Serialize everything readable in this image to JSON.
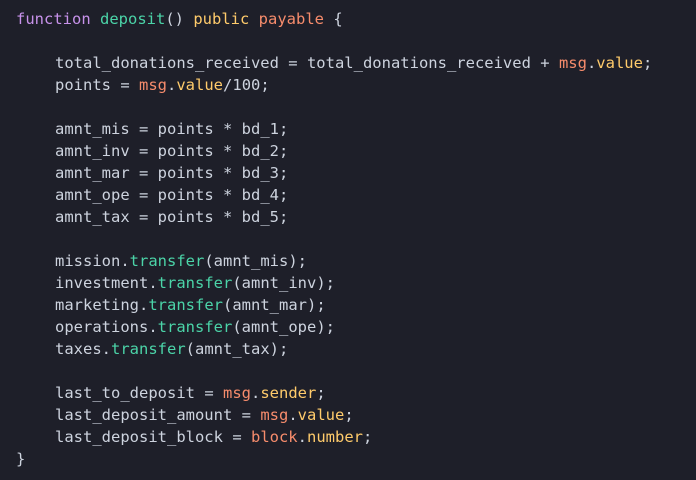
{
  "editor": {
    "background": "#1e1f29",
    "token_colors": {
      "keyword": "#c792ea",
      "function": "#82aaff",
      "member": "#f78c6c",
      "property": "#ffcb6b",
      "method": "#4bd4a8",
      "number": "#f78c6c",
      "text": "#cdd3de",
      "operator": "#89ddff",
      "punctuation": "#cdd3de"
    },
    "lines": [
      [
        {
          "t": "function",
          "c": "keyword"
        },
        {
          "t": " ",
          "c": "text"
        },
        {
          "t": "deposit",
          "c": "method"
        },
        {
          "t": "() ",
          "c": "punctuation"
        },
        {
          "t": "public",
          "c": "property"
        },
        {
          "t": " ",
          "c": "text"
        },
        {
          "t": "payable",
          "c": "member"
        },
        {
          "t": " {",
          "c": "punctuation"
        }
      ],
      [],
      [
        {
          "t": "total_donations_received",
          "c": "text"
        },
        {
          "t": " = ",
          "c": "text"
        },
        {
          "t": "total_donations_received",
          "c": "text"
        },
        {
          "t": " + ",
          "c": "text"
        },
        {
          "t": "msg",
          "c": "member"
        },
        {
          "t": ".",
          "c": "text"
        },
        {
          "t": "value",
          "c": "property"
        },
        {
          "t": ";",
          "c": "text"
        }
      ],
      [
        {
          "t": "points",
          "c": "text"
        },
        {
          "t": " = ",
          "c": "text"
        },
        {
          "t": "msg",
          "c": "member"
        },
        {
          "t": ".",
          "c": "text"
        },
        {
          "t": "value",
          "c": "property"
        },
        {
          "t": "/",
          "c": "text"
        },
        {
          "t": "100",
          "c": "text"
        },
        {
          "t": ";",
          "c": "text"
        }
      ],
      [],
      [
        {
          "t": "amnt_mis",
          "c": "text"
        },
        {
          "t": " = ",
          "c": "text"
        },
        {
          "t": "points",
          "c": "text"
        },
        {
          "t": " * ",
          "c": "text"
        },
        {
          "t": "bd_1",
          "c": "text"
        },
        {
          "t": ";",
          "c": "text"
        }
      ],
      [
        {
          "t": "amnt_inv",
          "c": "text"
        },
        {
          "t": " = ",
          "c": "text"
        },
        {
          "t": "points",
          "c": "text"
        },
        {
          "t": " * ",
          "c": "text"
        },
        {
          "t": "bd_2",
          "c": "text"
        },
        {
          "t": ";",
          "c": "text"
        }
      ],
      [
        {
          "t": "amnt_mar",
          "c": "text"
        },
        {
          "t": " = ",
          "c": "text"
        },
        {
          "t": "points",
          "c": "text"
        },
        {
          "t": " * ",
          "c": "text"
        },
        {
          "t": "bd_3",
          "c": "text"
        },
        {
          "t": ";",
          "c": "text"
        }
      ],
      [
        {
          "t": "amnt_ope",
          "c": "text"
        },
        {
          "t": " = ",
          "c": "text"
        },
        {
          "t": "points",
          "c": "text"
        },
        {
          "t": " * ",
          "c": "text"
        },
        {
          "t": "bd_4",
          "c": "text"
        },
        {
          "t": ";",
          "c": "text"
        }
      ],
      [
        {
          "t": "amnt_tax",
          "c": "text"
        },
        {
          "t": " = ",
          "c": "text"
        },
        {
          "t": "points",
          "c": "text"
        },
        {
          "t": " * ",
          "c": "text"
        },
        {
          "t": "bd_5",
          "c": "text"
        },
        {
          "t": ";",
          "c": "text"
        }
      ],
      [],
      [
        {
          "t": "mission",
          "c": "text"
        },
        {
          "t": ".",
          "c": "text"
        },
        {
          "t": "transfer",
          "c": "method"
        },
        {
          "t": "(amnt_mis);",
          "c": "text"
        }
      ],
      [
        {
          "t": "investment",
          "c": "text"
        },
        {
          "t": ".",
          "c": "text"
        },
        {
          "t": "transfer",
          "c": "method"
        },
        {
          "t": "(amnt_inv);",
          "c": "text"
        }
      ],
      [
        {
          "t": "marketing",
          "c": "text"
        },
        {
          "t": ".",
          "c": "text"
        },
        {
          "t": "transfer",
          "c": "method"
        },
        {
          "t": "(amnt_mar);",
          "c": "text"
        }
      ],
      [
        {
          "t": "operations",
          "c": "text"
        },
        {
          "t": ".",
          "c": "text"
        },
        {
          "t": "transfer",
          "c": "method"
        },
        {
          "t": "(amnt_ope);",
          "c": "text"
        }
      ],
      [
        {
          "t": "taxes",
          "c": "text"
        },
        {
          "t": ".",
          "c": "text"
        },
        {
          "t": "transfer",
          "c": "method"
        },
        {
          "t": "(amnt_tax);",
          "c": "text"
        }
      ],
      [],
      [
        {
          "t": "last_to_deposit",
          "c": "text"
        },
        {
          "t": " = ",
          "c": "text"
        },
        {
          "t": "msg",
          "c": "member"
        },
        {
          "t": ".",
          "c": "text"
        },
        {
          "t": "sender",
          "c": "property"
        },
        {
          "t": ";",
          "c": "text"
        }
      ],
      [
        {
          "t": "last_deposit_amount",
          "c": "text"
        },
        {
          "t": " = ",
          "c": "text"
        },
        {
          "t": "msg",
          "c": "member"
        },
        {
          "t": ".",
          "c": "text"
        },
        {
          "t": "value",
          "c": "property"
        },
        {
          "t": ";",
          "c": "text"
        }
      ],
      [
        {
          "t": "last_deposit_block",
          "c": "text"
        },
        {
          "t": " = ",
          "c": "text"
        },
        {
          "t": "block",
          "c": "member"
        },
        {
          "t": ".",
          "c": "text"
        },
        {
          "t": "number",
          "c": "property"
        },
        {
          "t": ";",
          "c": "text"
        }
      ],
      [
        {
          "t": "}",
          "c": "punctuation"
        }
      ]
    ]
  }
}
